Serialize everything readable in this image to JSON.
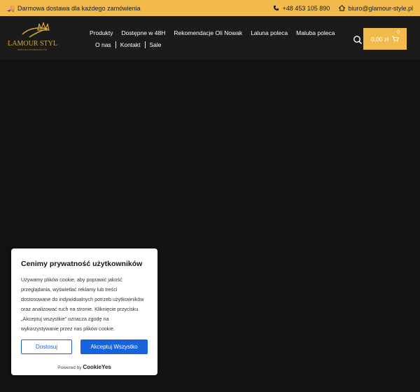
{
  "topbar": {
    "shipping_text": "Darmowa dostawa dla każdego zamówienia",
    "phone": "+48 453 105 890",
    "email": "biuro@glamour-style.pl"
  },
  "header": {
    "logo_text": "GLAMOUR STYLE",
    "logo_tagline": "MODA DLA WYMAGAJĄCYCH",
    "nav_row1": [
      "Produkty",
      "Dostępne w 48H",
      "Rekomendacje Oli Nowak",
      "Laluna poleca",
      "Maluba poleca"
    ],
    "nav_row2": [
      "O nas",
      "Kontakt",
      "Sale"
    ],
    "cart_total": "0,00 zł",
    "cart_count": "0"
  },
  "cookie": {
    "title": "Cenimy prywatność użytkowników",
    "body": "Używamy plików cookie, aby poprawić jakość przeglądania, wyświetlać reklamy lub treści dostosowane do indywidualnych potrzeb użytkowników oraz analizować ruch na stronie. Kliknięcie przycisku „Akceptuj wszystkie” oznacza zgodę na wykorzystywanie przez nas plików cookie.",
    "customize_label": "Dostosuj",
    "accept_label": "Akceptuj Wszystko",
    "powered_by": "Powered by",
    "brand": "CookieYes"
  },
  "colors": {
    "accent": "#f2b94b",
    "button_blue": "#1863dc",
    "page_bg": "#141414"
  },
  "icons": {
    "shipping": "truck-icon",
    "phone": "phone-icon",
    "email": "home-icon",
    "search": "search-icon",
    "cart": "cart-icon"
  }
}
